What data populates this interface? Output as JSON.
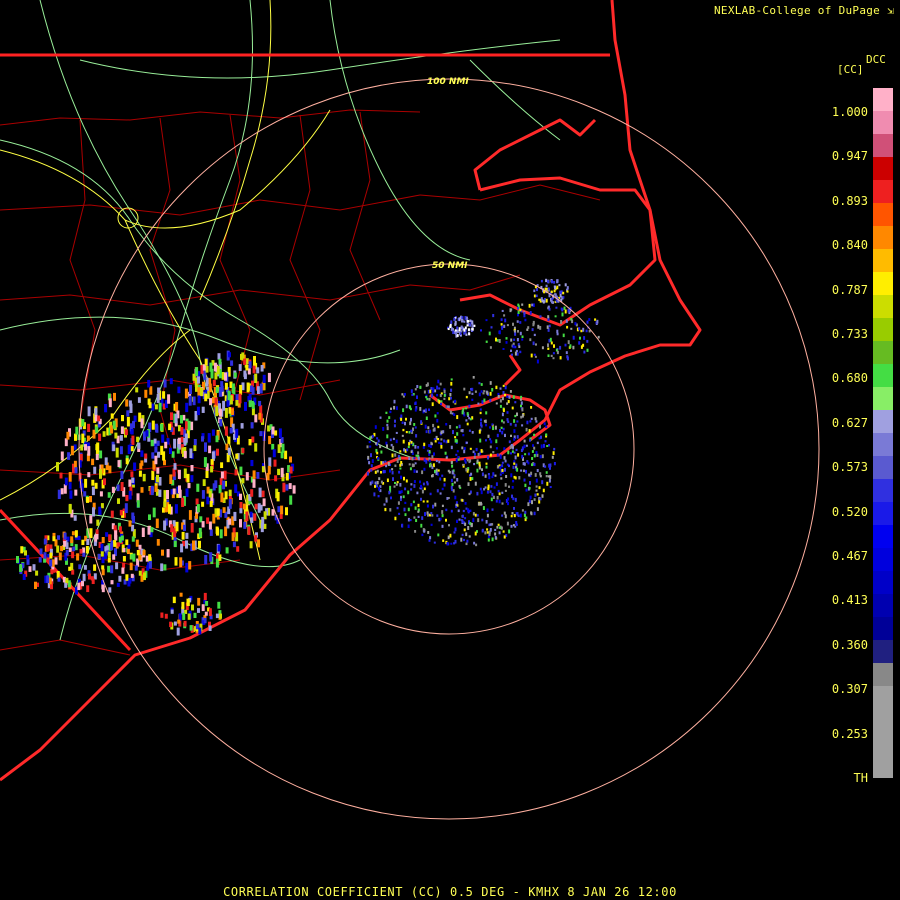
{
  "header": {
    "credit": "NEXLAB-College of DuPage",
    "credit_icon": "diagonal-arrow-icon"
  },
  "legend": {
    "product": "DCC",
    "unit": "[CC]",
    "ticks": [
      "1.000",
      "0.947",
      "0.893",
      "0.840",
      "0.787",
      "0.733",
      "0.680",
      "0.627",
      "0.573",
      "0.520",
      "0.467",
      "0.413",
      "0.360",
      "0.307",
      "0.253",
      "TH"
    ],
    "colors": [
      "#ffb0c8",
      "#f08cb0",
      "#d05078",
      "#cc0000",
      "#ee2020",
      "#ff5500",
      "#ff8800",
      "#ffbb00",
      "#ffee00",
      "#ccdd00",
      "#99cc00",
      "#66bb22",
      "#44dd44",
      "#88ee66",
      "#a0a0e0",
      "#7a7ad6",
      "#5a5ad0",
      "#3030e0",
      "#1a1ae8",
      "#0000f0",
      "#0000dd",
      "#0000c8",
      "#0000b0",
      "#000098",
      "#202080",
      "#888888",
      "#a0a0a0",
      "#a0a0a0",
      "#a0a0a0",
      "#a0a0a0",
      "#000000"
    ]
  },
  "range_rings": {
    "inner_label": "50 NMI",
    "outer_label": "100 NMI",
    "color": "#ffb0a0"
  },
  "map_colors": {
    "state_border": "#ff2222",
    "county_border": "#aa0000",
    "highway_primary": "#ffff44",
    "highway_secondary": "#99ee99",
    "coastline": "#ff2a2a"
  },
  "footer": {
    "caption": "CORRELATION COEFFICIENT (CC) 0.5 DEG - KMHX 8 JAN 26 12:00"
  }
}
